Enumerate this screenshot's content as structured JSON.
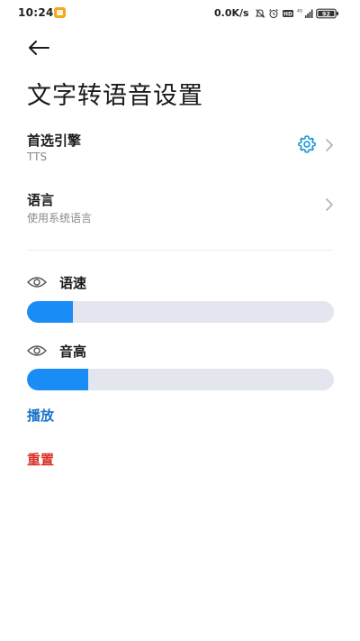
{
  "status_bar": {
    "time": "10:24",
    "network_speed": "0.0K/s",
    "battery_level": "92",
    "icons": [
      "notification-app-icon",
      "mute-icon",
      "alarm-icon",
      "hd-icon",
      "signal-icon",
      "battery-icon"
    ]
  },
  "header": {
    "back_icon": "arrow-left-icon",
    "title": "文字转语音设置"
  },
  "settings": {
    "preferred_engine": {
      "title": "首选引擎",
      "value": "TTS",
      "icon": "gear-icon"
    },
    "language": {
      "title": "语言",
      "value": "使用系统语言"
    }
  },
  "speech_rate": {
    "label": "语速",
    "level": 0.15
  },
  "pitch": {
    "label": "音高",
    "level": 0.2
  },
  "actions": {
    "play_label": "播放",
    "reset_label": "重置"
  },
  "colors": {
    "accent": "#1a8cf5",
    "track": "#e3e6ef",
    "gear": "#1e9ad6",
    "play": "#1a73c9",
    "reset": "#d93025"
  }
}
